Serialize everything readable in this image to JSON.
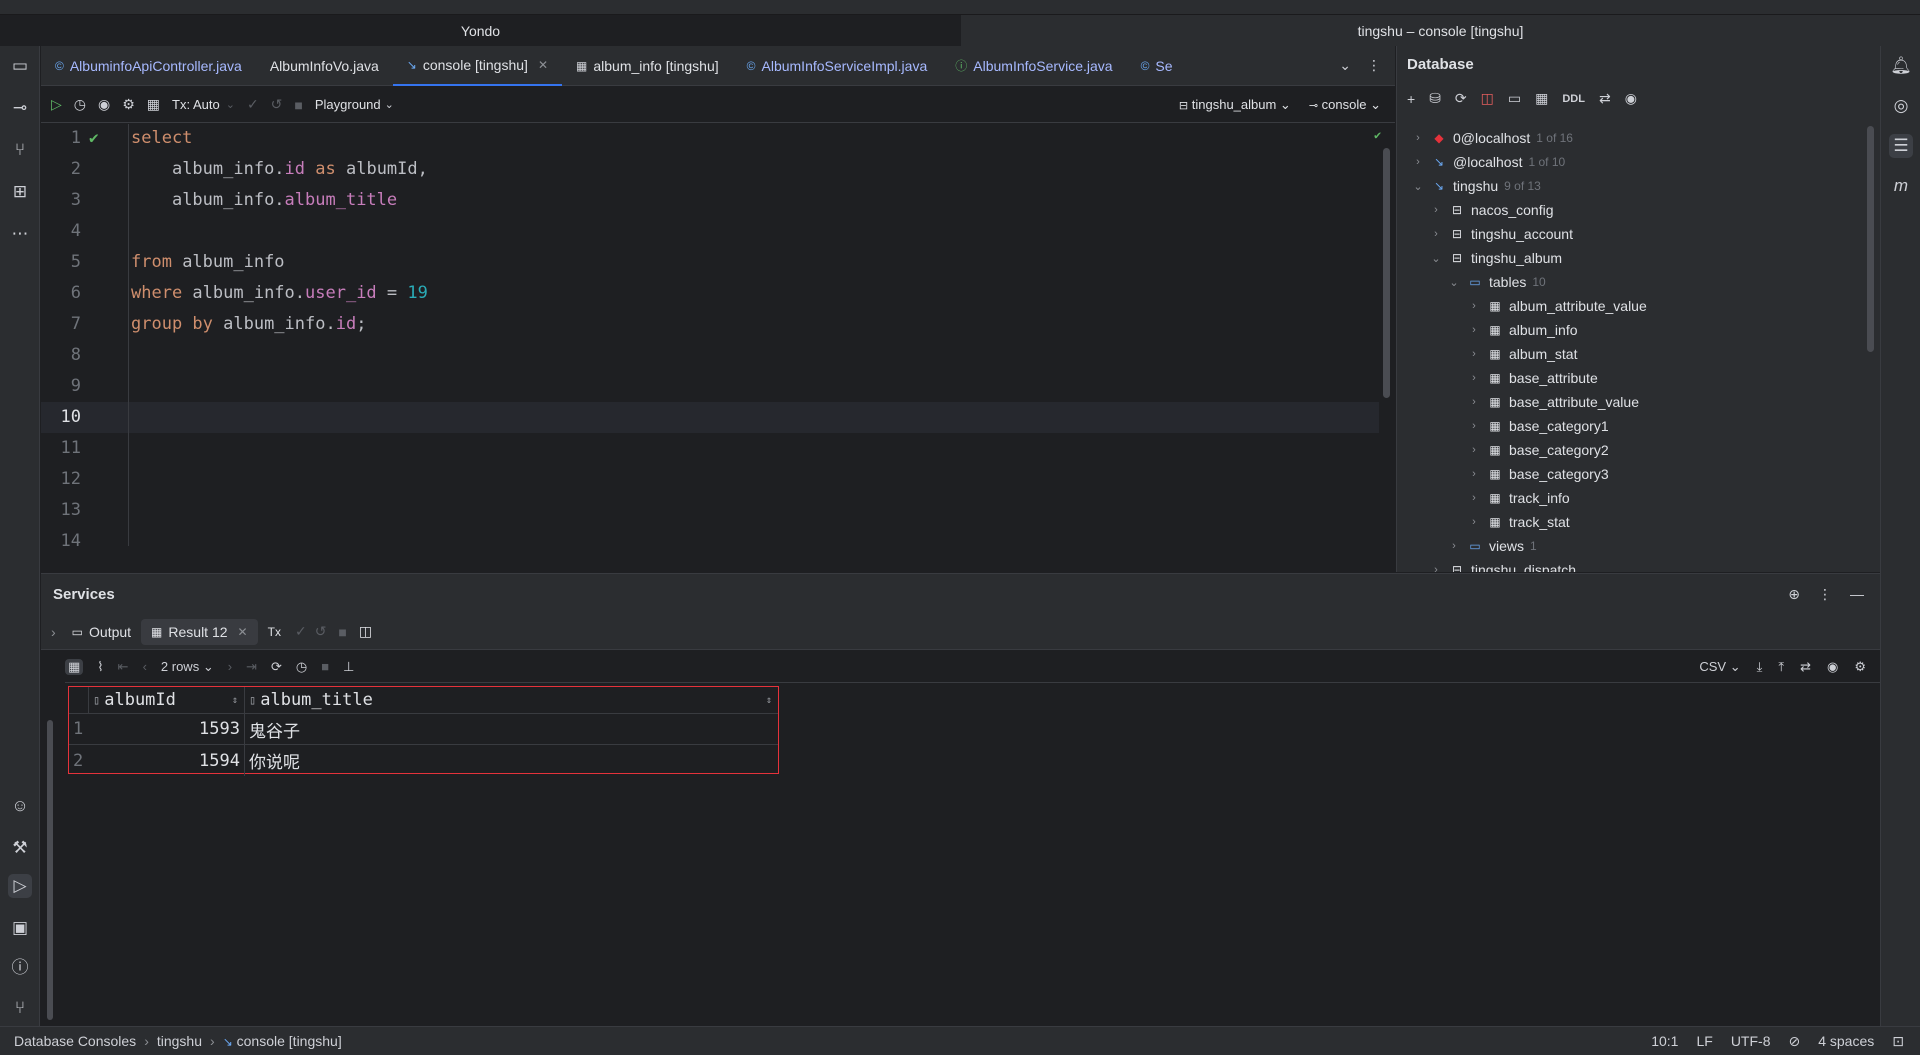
{
  "window": {
    "left_title": "Yondo",
    "right_title": "tingshu – console [tingshu]"
  },
  "tabs": [
    {
      "label": "AlbuminfoApiController.java",
      "icon": "java-class-icon",
      "closable": false
    },
    {
      "label": "AlbumInfoVo.java",
      "icon": "none",
      "closable": false
    },
    {
      "label": "console [tingshu]",
      "icon": "console-icon",
      "closable": true
    },
    {
      "label": "album_info [tingshu]",
      "icon": "table-icon",
      "closable": false
    },
    {
      "label": "AlbumInfoServiceImpl.java",
      "icon": "java-class-icon",
      "closable": false
    },
    {
      "label": "AlbumInfoService.java",
      "icon": "java-interface-icon",
      "closable": false
    },
    {
      "label": "Se",
      "icon": "service-icon",
      "closable": false
    }
  ],
  "editor_toolbar": {
    "tx_mode": "Tx: Auto",
    "playground": "Playground",
    "schema": "tingshu_album",
    "session": "console"
  },
  "editor": {
    "line_numbers": [
      "1",
      "2",
      "3",
      "4",
      "5",
      "6",
      "7",
      "8",
      "9",
      "10",
      "11",
      "12",
      "13",
      "14"
    ],
    "current_line": "10",
    "lines": {
      "l1": {
        "kw": "select"
      },
      "l2": {
        "t1": "album_info.",
        "f1": "id",
        "kw": " as ",
        "t2": "albumId,"
      },
      "l3": {
        "t1": "album_info.",
        "f1": "album_title"
      },
      "l5": {
        "kw": "from",
        "t1": " album_info"
      },
      "l6": {
        "kw": "where",
        "t1": " album_info.",
        "f1": "user_id",
        "t2": " = ",
        "n1": "19"
      },
      "l7": {
        "kw": "group by",
        "t1": " album_info.",
        "f1": "id",
        "t2": ";"
      }
    }
  },
  "database": {
    "title": "Database",
    "ddl": "DDL",
    "tree": [
      {
        "label": "0@localhost",
        "meta": "1 of 16",
        "depth": 0,
        "icon": "redis-icon",
        "open": false
      },
      {
        "label": "@localhost",
        "meta": "1 of 10",
        "depth": 0,
        "icon": "mysql-icon",
        "open": false
      },
      {
        "label": "tingshu",
        "meta": "9 of 13",
        "depth": 0,
        "icon": "mysql-icon",
        "open": true
      },
      {
        "label": "nacos_config",
        "meta": "",
        "depth": 1,
        "icon": "schema-icon",
        "open": false
      },
      {
        "label": "tingshu_account",
        "meta": "",
        "depth": 1,
        "icon": "schema-icon",
        "open": false
      },
      {
        "label": "tingshu_album",
        "meta": "",
        "depth": 1,
        "icon": "schema-icon",
        "open": true
      },
      {
        "label": "tables",
        "meta": "10",
        "depth": 2,
        "icon": "folder-icon",
        "open": true
      },
      {
        "label": "album_attribute_value",
        "meta": "",
        "depth": 3,
        "icon": "table-icon",
        "open": false
      },
      {
        "label": "album_info",
        "meta": "",
        "depth": 3,
        "icon": "table-icon",
        "open": false
      },
      {
        "label": "album_stat",
        "meta": "",
        "depth": 3,
        "icon": "table-icon",
        "open": false
      },
      {
        "label": "base_attribute",
        "meta": "",
        "depth": 3,
        "icon": "table-icon",
        "open": false
      },
      {
        "label": "base_attribute_value",
        "meta": "",
        "depth": 3,
        "icon": "table-icon",
        "open": false
      },
      {
        "label": "base_category1",
        "meta": "",
        "depth": 3,
        "icon": "table-icon",
        "open": false
      },
      {
        "label": "base_category2",
        "meta": "",
        "depth": 3,
        "icon": "table-icon",
        "open": false
      },
      {
        "label": "base_category3",
        "meta": "",
        "depth": 3,
        "icon": "table-icon",
        "open": false
      },
      {
        "label": "track_info",
        "meta": "",
        "depth": 3,
        "icon": "table-icon",
        "open": false
      },
      {
        "label": "track_stat",
        "meta": "",
        "depth": 3,
        "icon": "table-icon",
        "open": false
      },
      {
        "label": "views",
        "meta": "1",
        "depth": 2,
        "icon": "folder-icon",
        "open": false
      },
      {
        "label": "tingshu_dispatch",
        "meta": "",
        "depth": 1,
        "icon": "schema-icon",
        "open": false
      }
    ]
  },
  "services": {
    "title": "Services",
    "tabs": {
      "output": "Output",
      "result": "Result 12",
      "tx": "Tx"
    },
    "rows_label": "2 rows",
    "export_format": "CSV",
    "columns": [
      "albumId",
      "album_title"
    ],
    "rows": [
      {
        "n": "1",
        "albumId": "1593",
        "album_title": "鬼谷子"
      },
      {
        "n": "2",
        "albumId": "1594",
        "album_title": "你说呢"
      }
    ]
  },
  "status": {
    "crumbs": [
      "Database Consoles",
      "tingshu",
      "console [tingshu]"
    ],
    "position": "10:1",
    "line_ending": "LF",
    "encoding": "UTF-8",
    "indent": "4 spaces"
  }
}
